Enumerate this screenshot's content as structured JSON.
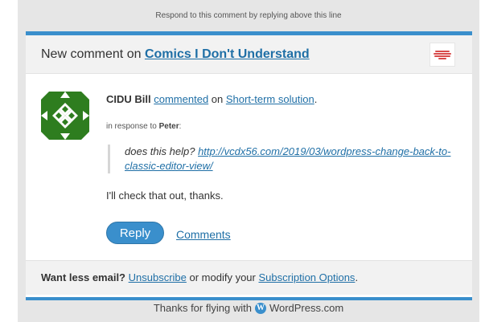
{
  "top_note": "Respond to this comment by replying above this line",
  "header": {
    "prefix": "New comment on ",
    "blog_title": "Comics I Don't Understand"
  },
  "comment": {
    "author": "CIDU Bill",
    "action": "commented",
    "on_word": " on ",
    "post_title": "Short-term solution",
    "post_suffix": ".",
    "in_response_prefix": "in response to ",
    "in_response_name": "Peter",
    "in_response_suffix": ":",
    "quote_text": "does this help? ",
    "quote_link": "http://vcdx56.com/2019/03/wordpress-change-back-to-classic-editor-view/",
    "body": "I'll check that out, thanks."
  },
  "actions": {
    "reply_label": "Reply",
    "comments_label": "Comments"
  },
  "footer": {
    "lead": "Want less email?",
    "unsubscribe": "Unsubscribe",
    "middle": " or modify your ",
    "subscription_options": "Subscription Options",
    "end": "."
  },
  "wp_line": {
    "prefix": "Thanks for flying with",
    "brand": "WordPress.com"
  },
  "colors": {
    "accent": "#3a8fcc",
    "link": "#1f6fa6",
    "avatar_green": "#2e7d1f"
  }
}
